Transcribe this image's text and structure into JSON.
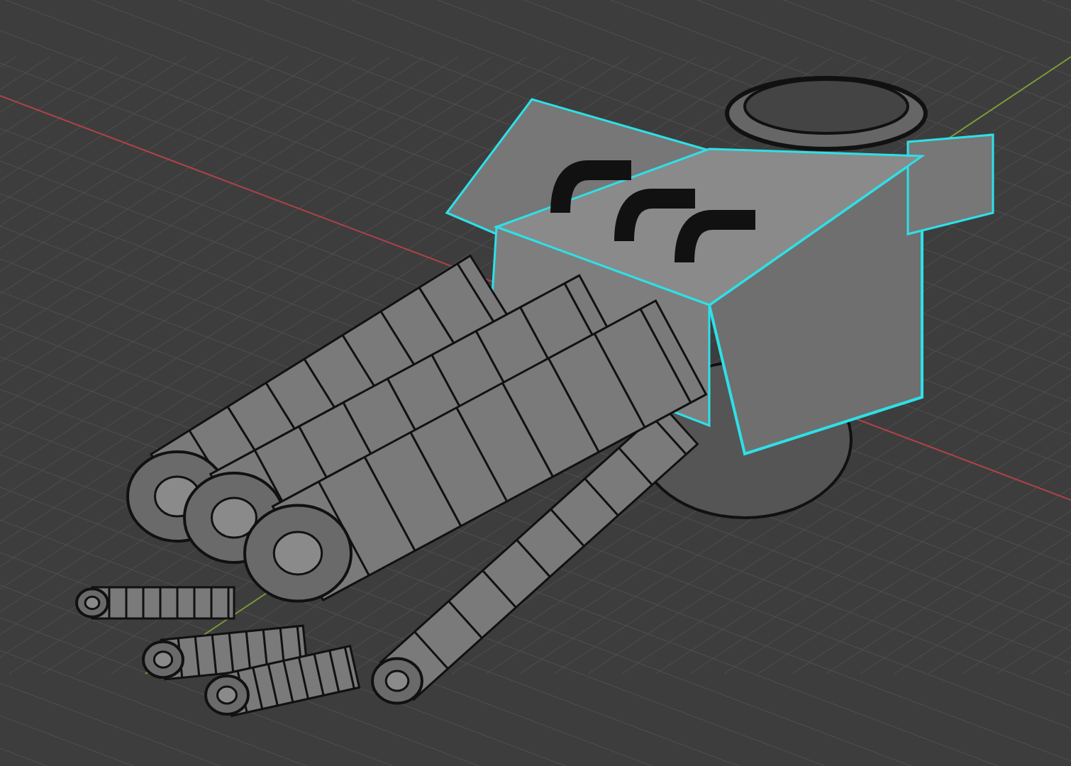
{
  "viewport": {
    "axes": [
      {
        "kind": "x",
        "color": "#b0424a"
      },
      {
        "kind": "y",
        "color": "#7a9a3a"
      }
    ]
  }
}
